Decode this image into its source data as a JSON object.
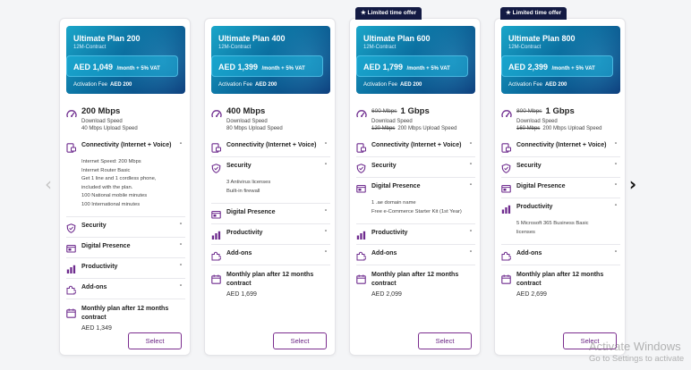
{
  "navigation": {
    "prev_icon": "chevron-left-icon",
    "next_icon": "chevron-right-icon"
  },
  "colors": {
    "accent": "#7b2d8e",
    "badge_bg": "#131a43",
    "hero_start": "#1aa6c9",
    "hero_end": "#0c3b7a",
    "icon_purple": "#6e2b8e"
  },
  "offer_label": "Limited time offer",
  "select_label": "Select",
  "monthly_title": "Monthly plan after 12 months contract",
  "download_label": "Download Speed",
  "cards": [
    {
      "plan_name": "Ultimate Plan 200",
      "contract": "12M-Contract",
      "price": "AED 1,049",
      "price_suffix": "/month + 5% VAT",
      "activation_label": "Activation Fee",
      "activation_value": "AED 200",
      "speed": "200 Mbps",
      "upload": "40 Mbps Upload Speed",
      "sections": [
        {
          "title": "Connectivity (Internet + Voice)",
          "icon": "chat-phone-icon",
          "expanded": true,
          "details": [
            "Internet Speed: 200 Mbps",
            "Internet Router Basic",
            "Get 1 line and 1 cordless phone,",
            "included with the plan.",
            "100 National mobile minutes",
            "100 International minutes"
          ]
        },
        {
          "title": "Security",
          "icon": "shield-icon",
          "expanded": false,
          "details": []
        },
        {
          "title": "Digital Presence",
          "icon": "website-icon",
          "expanded": false,
          "details": []
        },
        {
          "title": "Productivity",
          "icon": "productivity-icon",
          "expanded": false,
          "details": []
        },
        {
          "title": "Add-ons",
          "icon": "puzzle-icon",
          "expanded": false,
          "details": []
        }
      ],
      "monthly_price": "AED 1,349"
    },
    {
      "plan_name": "Ultimate Plan 400",
      "contract": "12M-Contract",
      "price": "AED 1,399",
      "price_suffix": "/month + 5% VAT",
      "activation_label": "Activation Fee",
      "activation_value": "AED 200",
      "speed": "400 Mbps",
      "upload": "80 Mbps Upload Speed",
      "sections": [
        {
          "title": "Connectivity (Internet + Voice)",
          "icon": "chat-phone-icon",
          "expanded": false,
          "details": []
        },
        {
          "title": "Security",
          "icon": "shield-icon",
          "expanded": true,
          "details": [
            "3 Antivirus licenses",
            "Built-in firewall"
          ]
        },
        {
          "title": "Digital Presence",
          "icon": "website-icon",
          "expanded": false,
          "details": []
        },
        {
          "title": "Productivity",
          "icon": "productivity-icon",
          "expanded": false,
          "details": []
        },
        {
          "title": "Add-ons",
          "icon": "puzzle-icon",
          "expanded": false,
          "details": []
        }
      ],
      "monthly_price": "AED 1,699"
    },
    {
      "offer": true,
      "plan_name": "Ultimate Plan 600",
      "contract": "12M-Contract",
      "price": "AED 1,799",
      "price_suffix": "/month + 5% VAT",
      "activation_label": "Activation Fee",
      "activation_value": "AED 200",
      "speed_old": "600 Mbps",
      "speed": "1 Gbps",
      "upload_old": "120 Mbps",
      "upload": "200 Mbps Upload Speed",
      "sections": [
        {
          "title": "Connectivity (Internet + Voice)",
          "icon": "chat-phone-icon",
          "expanded": false,
          "details": []
        },
        {
          "title": "Security",
          "icon": "shield-icon",
          "expanded": false,
          "details": []
        },
        {
          "title": "Digital Presence",
          "icon": "website-icon",
          "expanded": true,
          "details": [
            "1 .ae domain name",
            "Free e-Commerce Starter Kit (1st Year)"
          ]
        },
        {
          "title": "Productivity",
          "icon": "productivity-icon",
          "expanded": false,
          "details": []
        },
        {
          "title": "Add-ons",
          "icon": "puzzle-icon",
          "expanded": false,
          "details": []
        }
      ],
      "monthly_price": "AED 2,099"
    },
    {
      "offer": true,
      "plan_name": "Ultimate Plan 800",
      "contract": "12M-Contract",
      "price": "AED 2,399",
      "price_suffix": "/month + 5% VAT",
      "activation_label": "Activation Fee",
      "activation_value": "AED 200",
      "speed_old": "800 Mbps",
      "speed": "1 Gbps",
      "upload_old": "160 Mbps",
      "upload": "200 Mbps Upload Speed",
      "sections": [
        {
          "title": "Connectivity (Internet + Voice)",
          "icon": "chat-phone-icon",
          "expanded": false,
          "details": []
        },
        {
          "title": "Security",
          "icon": "shield-icon",
          "expanded": false,
          "details": []
        },
        {
          "title": "Digital Presence",
          "icon": "website-icon",
          "expanded": false,
          "details": []
        },
        {
          "title": "Productivity",
          "icon": "productivity-icon",
          "expanded": true,
          "details": [
            "5 Microsoft 365 Business Basic",
            "licenses"
          ]
        },
        {
          "title": "Add-ons",
          "icon": "puzzle-icon",
          "expanded": false,
          "details": []
        }
      ],
      "monthly_price": "AED 2,699"
    }
  ],
  "watermark": {
    "line1": "Activate Windows",
    "line2": "Go to Settings to activate"
  }
}
